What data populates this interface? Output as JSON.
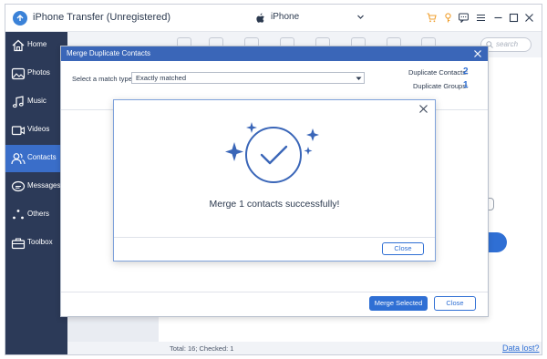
{
  "window": {
    "title": "iPhone Transfer (Unregistered)",
    "device_name": "iPhone",
    "toolbar_icons": [
      "cart-icon",
      "key-icon",
      "chat-icon",
      "menu-icon",
      "minimize-icon",
      "maximize-icon",
      "close-icon"
    ]
  },
  "sidebar": {
    "items": [
      {
        "label": "Home",
        "icon": "home-icon"
      },
      {
        "label": "Photos",
        "icon": "photos-icon"
      },
      {
        "label": "Music",
        "icon": "music-icon"
      },
      {
        "label": "Videos",
        "icon": "videos-icon"
      },
      {
        "label": "Contacts",
        "icon": "contacts-icon",
        "active": true
      },
      {
        "label": "Messages",
        "icon": "messages-icon"
      },
      {
        "label": "Others",
        "icon": "others-icon"
      },
      {
        "label": "Toolbox",
        "icon": "toolbox-icon"
      }
    ]
  },
  "main": {
    "search_placeholder": "search",
    "status": "Total: 16; Checked: 1",
    "data_lost_link": "Data lost?",
    "bg_button_label": "t"
  },
  "merge_dialog": {
    "title": "Merge Duplicate Contacts",
    "match_label": "Select a match type:",
    "match_value": "Exactly matched",
    "duplicate_contacts_label": "Duplicate Contacts:",
    "duplicate_contacts_value": "2",
    "duplicate_groups_label": "Duplicate Groups:",
    "duplicate_groups_value": "1",
    "merge_selected_button": "Merge Selected",
    "close_button": "Close"
  },
  "success_dialog": {
    "message": "Merge 1 contacts successfully!",
    "close_button": "Close"
  },
  "colors": {
    "accent": "#2f6fd4",
    "sidebar": "#2c3a58",
    "active_nav": "#3a6ec9",
    "dialog_header": "#3a66b8",
    "icon_orange": "#f0a030"
  }
}
